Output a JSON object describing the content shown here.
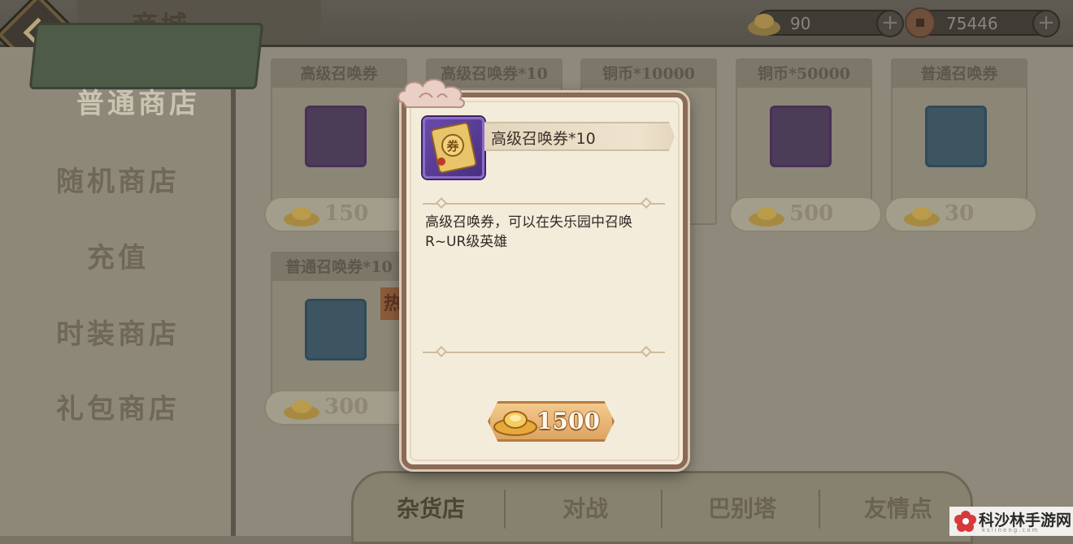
{
  "header": {
    "title": "商城",
    "currencies": [
      {
        "icon": "gold-ingot-icon",
        "value": "90"
      },
      {
        "icon": "copper-coin-icon",
        "value": "75446"
      }
    ]
  },
  "sidebar": {
    "active": "普通商店",
    "items": [
      "随机商店",
      "充值",
      "时装商店",
      "礼包商店"
    ]
  },
  "shop_items": [
    {
      "name": "高级召唤券",
      "price": "150",
      "icon": "summon-ticket-icon"
    },
    {
      "name": "高级召唤券*10",
      "price": "",
      "icon": "summon-ticket-icon"
    },
    {
      "name": "铜币*10000",
      "price": "",
      "icon": "copper-coin-icon"
    },
    {
      "name": "铜币*50000",
      "price": "500",
      "icon": "copper-coin-icon"
    },
    {
      "name": "普通召唤券",
      "price": "30",
      "icon": "normal-ticket-icon"
    },
    {
      "name": "普通召唤券*10",
      "price": "300",
      "icon": "normal-ticket-icon"
    }
  ],
  "hot_badge": "热",
  "bottom_tabs": [
    "杂货店",
    "对战",
    "巴别塔",
    "友情点"
  ],
  "modal": {
    "item_name": "高级召唤券*10",
    "description": "高级召唤券，可以在失乐园中召唤R~UR级英雄",
    "price": "1500"
  },
  "watermark": {
    "text": "科沙林手游网",
    "sub": "kslineng.com"
  },
  "colors": {
    "modal_bg": "#f4ecdb",
    "modal_border": "#8b6a57",
    "buy_button": "#dda462",
    "ticket_purple": "#6a4aa8"
  }
}
